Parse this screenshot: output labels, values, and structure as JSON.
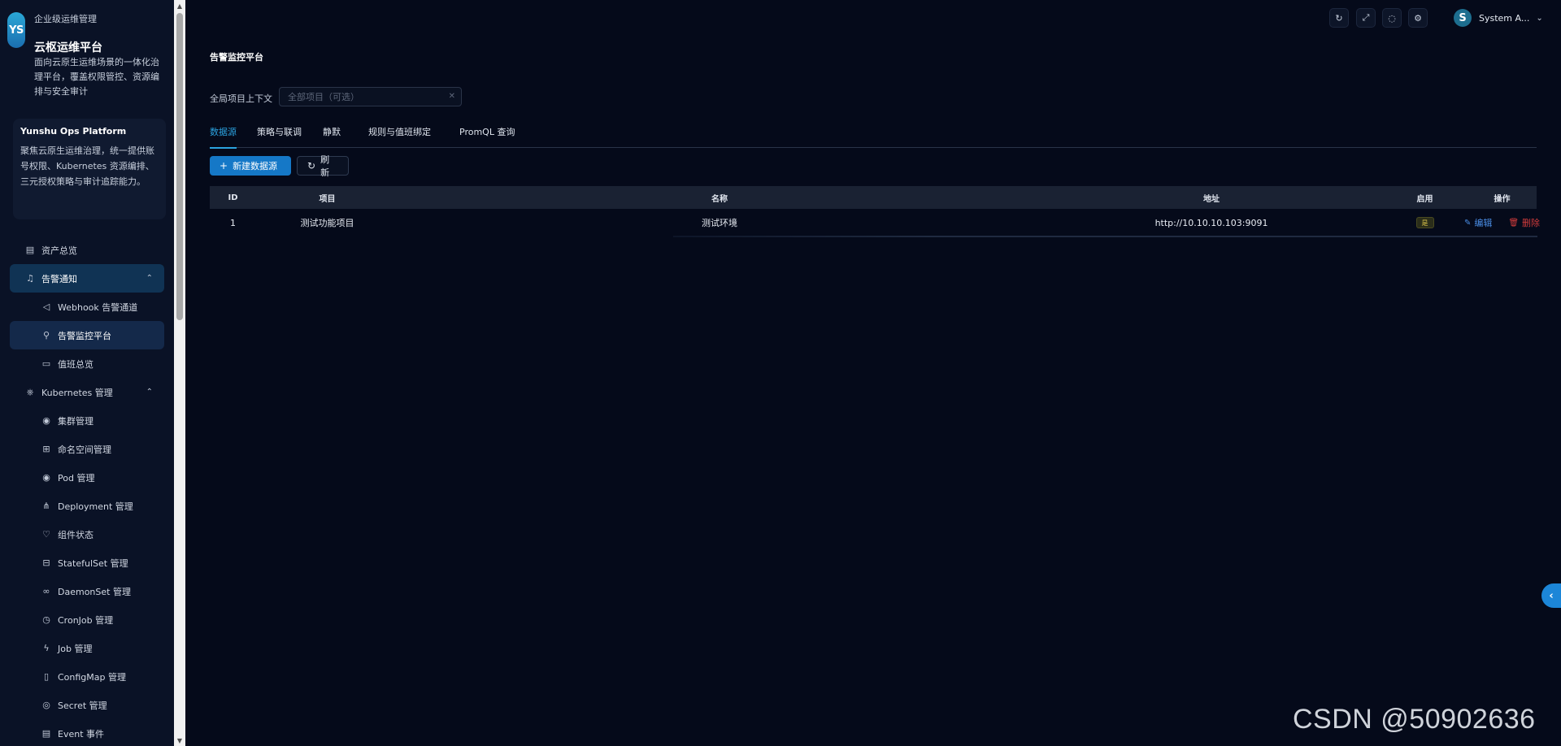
{
  "brand": {
    "logo_text": "YS",
    "subtitle": "企业级运维管理",
    "title": "云枢运维平台",
    "description": "面向云原生运维场景的一体化治理平台，覆盖权限管控、资源编排与安全审计"
  },
  "intro_card": {
    "title": "Yunshu Ops Platform",
    "description": "聚焦云原生运维治理，统一提供账号权限、Kubernetes 资源编排、三元授权策略与审计追踪能力。"
  },
  "nav": {
    "asset": "资产总览",
    "alert": "告警通知",
    "webhook": "Webhook 告警通道",
    "monitor": "告警监控平台",
    "oncall": "值班总览",
    "k8s": "Kubernetes 管理",
    "cluster": "集群管理",
    "namespace": "命名空间管理",
    "pod": "Pod 管理",
    "deployment": "Deployment 管理",
    "component": "组件状态",
    "statefulset": "StatefulSet 管理",
    "daemonset": "DaemonSet 管理",
    "cronjob": "CronJob 管理",
    "job": "Job 管理",
    "configmap": "ConfigMap 管理",
    "secret": "Secret 管理",
    "event": "Event 事件"
  },
  "header": {
    "user_initial": "S",
    "user_name": "System A..."
  },
  "main": {
    "page_title": "告警监控平台",
    "context_label": "全局项目上下文",
    "context_placeholder": "全部项目（可选）",
    "tabs": [
      "数据源",
      "策略与联调",
      "静默",
      "规则与值班绑定",
      "PromQL 查询"
    ],
    "new_button": "新建数据源",
    "refresh_button": "刷新"
  },
  "table": {
    "headers": [
      "ID",
      "项目",
      "名称",
      "地址",
      "启用",
      "操作"
    ],
    "rows": [
      {
        "id": "1",
        "project": "测试功能项目",
        "name": "测试环境",
        "address": "http://10.10.10.103:9091",
        "enabled": "是",
        "edit": "编辑",
        "delete": "删除"
      }
    ]
  },
  "watermark": "CSDN @50902636",
  "colors": {
    "background": "#050a1a",
    "sidebar": "#0a1226",
    "accent": "#2ba3e0",
    "primary_button": "#1578c7",
    "danger": "#d23c3c",
    "link": "#4a8ee6"
  }
}
